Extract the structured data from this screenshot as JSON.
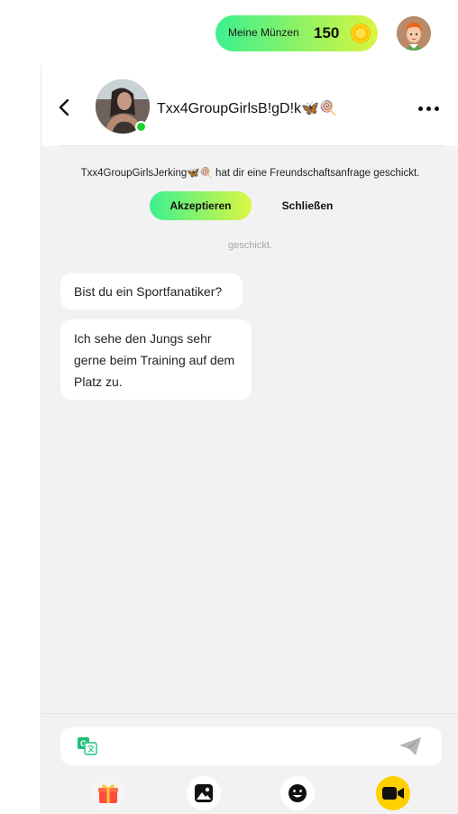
{
  "wallet": {
    "label": "Meine Münzen",
    "amount": "150",
    "coin_icon": "coin-icon"
  },
  "profile": {
    "icon": "user-avatar"
  },
  "chat": {
    "contact_name": "Txx4GroupGirlsB!gD!k🦋🍭",
    "online_color": "#19d12c",
    "more_icon": "more-dots-icon",
    "back_icon": "chevron-left-icon"
  },
  "friend_request": {
    "text": "Txx4GroupGirlsJerking🦋🍭 hat dir eine Freundschaftsanfrage geschickt.",
    "accept_label": "Akzeptieren",
    "close_label": "Schließen",
    "status": "geschickt."
  },
  "messages": [
    {
      "text": "Bist du ein Sportfanatiker?"
    },
    {
      "text": "Ich sehe den Jungs sehr gerne beim Training auf dem Platz zu."
    }
  ],
  "composer": {
    "placeholder": "",
    "translate_icon": "translate-icon",
    "send_icon": "send-icon"
  },
  "toolbar": [
    {
      "icon": "gift-icon"
    },
    {
      "icon": "image-icon"
    },
    {
      "icon": "emoji-icon"
    },
    {
      "icon": "video-call-icon"
    }
  ],
  "colors": {
    "accent_gradient_start": "#3cf08f",
    "accent_gradient_end": "#dcf642",
    "video_button": "#ffd000",
    "chat_background": "#f2f2f2"
  }
}
